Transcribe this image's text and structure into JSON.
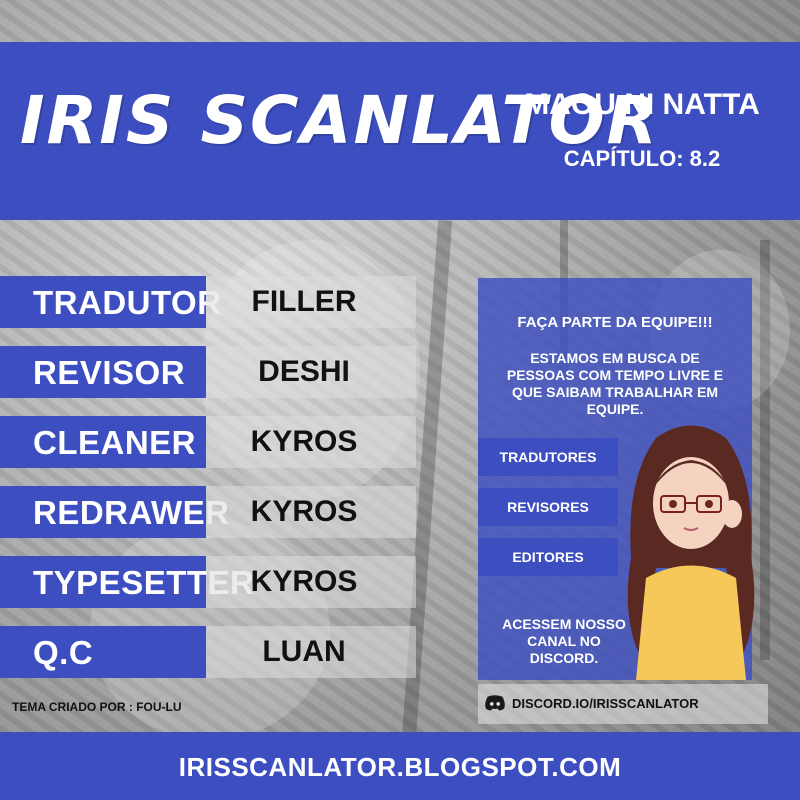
{
  "header": {
    "logo_text": "IRIS SCANLATOR",
    "title": "MAOU NI NATTA",
    "chapter": "CAPÍTULO: 8.2"
  },
  "credits": [
    {
      "role": "TRADUTOR",
      "name": "FILLER"
    },
    {
      "role": "REVISOR",
      "name": "DESHI"
    },
    {
      "role": "CLEANER",
      "name": "KYROS"
    },
    {
      "role": "REDRAWER",
      "name": "KYROS"
    },
    {
      "role": "TYPESETTER",
      "name": "KYROS"
    },
    {
      "role": "Q.C",
      "name": "LUAN"
    }
  ],
  "theme_credit": "TEMA CRIADO POR : FOU-LU",
  "recruit": {
    "heading": "FAÇA PARTE DA EQUIPE!!!",
    "body": "ESTAMOS EM BUSCA DE PESSOAS COM TEMPO LIVRE E QUE SAIBAM TRABALHAR EM EQUIPE.",
    "roles": [
      "TRADUTORES",
      "REVISORES",
      "EDITORES"
    ],
    "footer": "ACESSEM NOSSO CANAL NO DISCORD."
  },
  "discord": {
    "icon": "discord-icon",
    "link": "DISCORD.IO/IRISSCANLATOR"
  },
  "footer": {
    "url": "IRISSCANLATOR.BLOGSPOT.COM"
  },
  "colors": {
    "brand_blue": "#3d4fc0"
  }
}
